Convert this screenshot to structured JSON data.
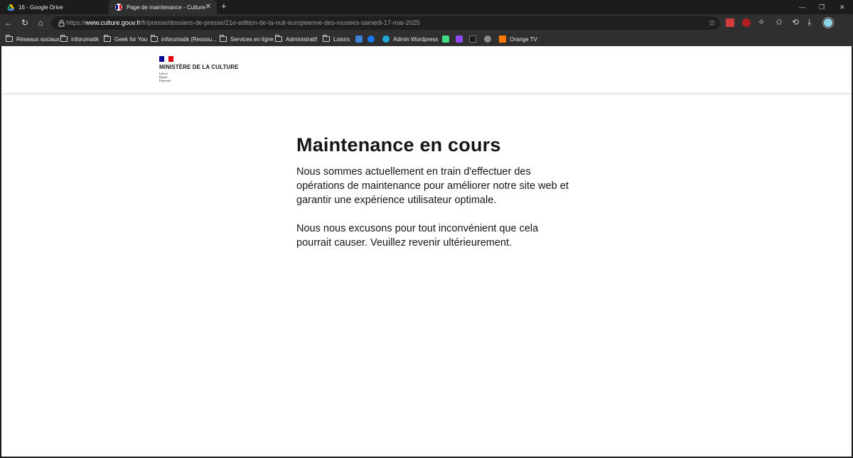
{
  "browser": {
    "tabs": [
      {
        "title": "16 - Google Drive",
        "icon": "google-drive-icon"
      },
      {
        "title": "Page de maintenance - Culture.gouv.fr",
        "icon": "marianne-icon",
        "close": "✕"
      }
    ],
    "new_tab": "+",
    "window_controls": {
      "minimize": "—",
      "restore": "❐",
      "close": "✕"
    },
    "nav": {
      "back": "←",
      "reload": "↻",
      "home": "⌂"
    },
    "address": {
      "scheme": "https://",
      "host": "www.culture.gouv.fr",
      "path": "/fr/presse/dossiers-de-presse/21e-edition-de-la-nuit-europeenne-des-musees-samedi-17-mai-2025"
    },
    "favorite_star": "☆",
    "extensions": [
      {
        "name": "extension-red-icon",
        "color": "#d23c3c"
      },
      {
        "name": "extension-ublock-icon",
        "color": "#b11f24"
      }
    ],
    "toolbar_icons": {
      "extensions": "✧",
      "favorites": "✩",
      "history": "⟲",
      "downloads": "⤓"
    },
    "bookmarks": [
      {
        "label": "Réseaux sociaux",
        "type": "folder"
      },
      {
        "label": "inforumatik",
        "type": "folder"
      },
      {
        "label": "Geek for You",
        "type": "folder"
      },
      {
        "label": "inforumatik (Ressou...",
        "type": "folder"
      },
      {
        "label": "Services en ligne",
        "type": "folder"
      },
      {
        "label": "Administratif",
        "type": "folder"
      },
      {
        "label": "Loisirs",
        "type": "folder"
      },
      {
        "label": "",
        "type": "icon",
        "color": "#3b82d6"
      },
      {
        "label": "",
        "type": "icon",
        "color": "#1877f2"
      },
      {
        "label": "Admin Wordpress",
        "type": "site",
        "color": "#23a8d8"
      },
      {
        "label": "",
        "type": "icon",
        "color": "#3ddc84"
      },
      {
        "label": "",
        "type": "icon",
        "color": "#9146ff"
      },
      {
        "label": "",
        "type": "icon",
        "color": "#1a1a1a"
      },
      {
        "label": "",
        "type": "icon",
        "color": "#8a8a8a"
      },
      {
        "label": "Orange TV",
        "type": "site",
        "color": "#ff7900"
      }
    ]
  },
  "page": {
    "logo": {
      "ministry": "MINISTÈRE DE LA CULTURE",
      "motto": [
        "Liberté",
        "Égalité",
        "Fraternité"
      ],
      "flag_colors": [
        "#000091",
        "#ffffff",
        "#e1000f"
      ]
    },
    "title": "Maintenance en cours",
    "paragraphs": [
      "Nous sommes actuellement en train d'effectuer des opérations de maintenance pour améliorer notre site web et garantir une expérience utilisateur optimale.",
      "Nous nous excusons pour tout inconvénient que cela pourrait causer. Veuillez revenir ultérieurement."
    ]
  }
}
